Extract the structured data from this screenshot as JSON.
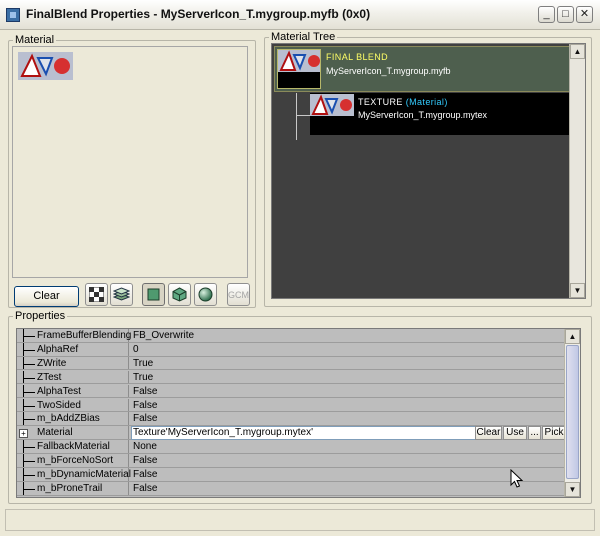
{
  "window": {
    "title": "FinalBlend Properties - MyServerIcon_T.mygroup.myfb (0x0)",
    "min_glyph": "_",
    "max_glyph": "□",
    "close_glyph": "✕"
  },
  "material_panel": {
    "label": "Material"
  },
  "tree_panel": {
    "label": "Material Tree",
    "root": {
      "title": "FINAL BLEND",
      "subtitle": "MyServerIcon_T.mygroup.myfb"
    },
    "child": {
      "title": "TEXTURE",
      "tag": "(Material)",
      "subtitle": "MyServerIcon_T.mygroup.mytex"
    }
  },
  "toolbar": {
    "clear_label": "Clear",
    "gcm_label": "GCM"
  },
  "properties": {
    "label": "Properties",
    "rows": [
      {
        "name": "FrameBufferBlending",
        "value": "FB_Overwrite"
      },
      {
        "name": "AlphaRef",
        "value": "0"
      },
      {
        "name": "ZWrite",
        "value": "True"
      },
      {
        "name": "ZTest",
        "value": "True"
      },
      {
        "name": "AlphaTest",
        "value": "False"
      },
      {
        "name": "TwoSided",
        "value": "False"
      },
      {
        "name": "m_bAddZBias",
        "value": "False"
      },
      {
        "name": "Material",
        "value": "Texture'MyServerIcon_T.mygroup.mytex'"
      },
      {
        "name": "FallbackMaterial",
        "value": "None"
      },
      {
        "name": "m_bForceNoSort",
        "value": "False"
      },
      {
        "name": "m_bDynamicMaterial",
        "value": "False"
      },
      {
        "name": "m_bProneTrail",
        "value": "False"
      }
    ],
    "material_buttons": {
      "clear": "Clear",
      "use": "Use",
      "browse": "...",
      "pick": "Pick"
    },
    "expander_glyph": "+"
  },
  "colors": {
    "window_bg": "#ece9d8",
    "tree_bg": "#404040",
    "root_node_bg": "#4e5f4e",
    "final_blend_title": "#ffff66",
    "material_tag": "#33ccff"
  }
}
